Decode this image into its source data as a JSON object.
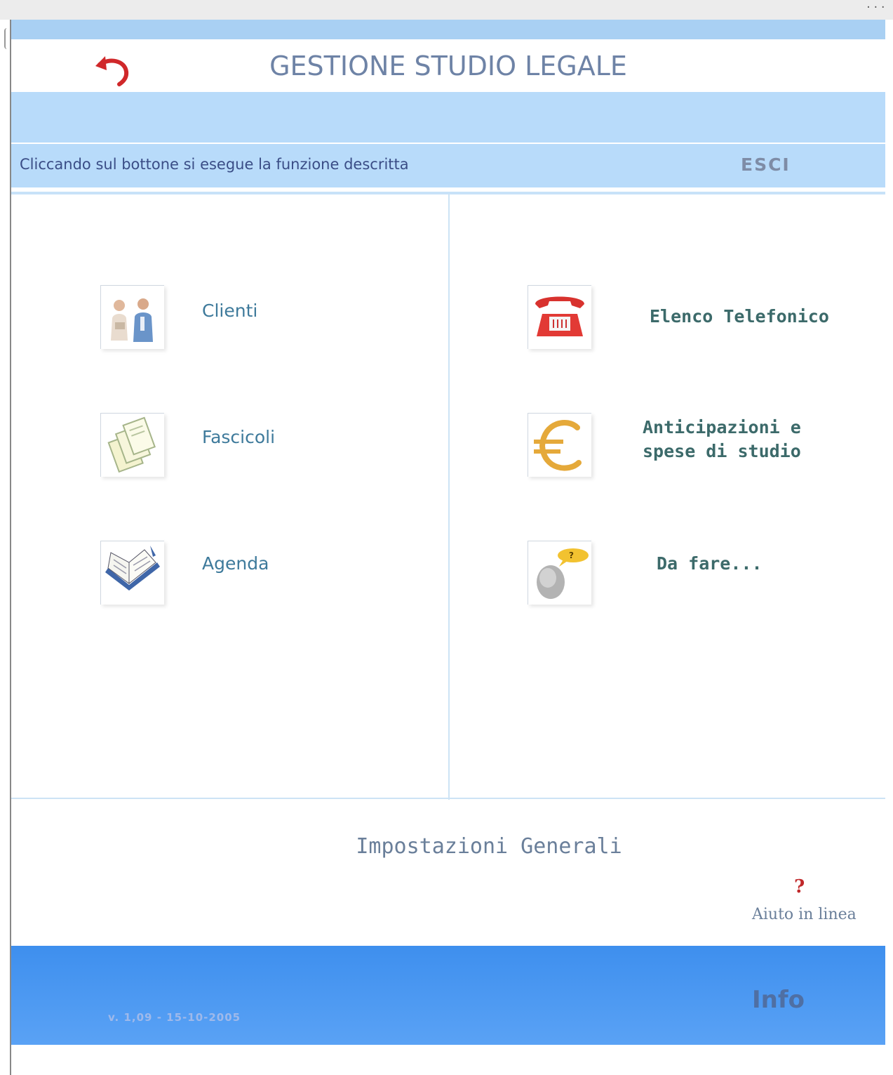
{
  "window": {
    "corner_text": "..."
  },
  "header": {
    "title": "GESTIONE STUDIO LEGALE",
    "back_icon": "back-arrow-icon",
    "info_text": "Cliccando sul bottone si esegue la funzione descritta",
    "exit_label": "ESCI"
  },
  "menu": {
    "left": [
      {
        "label": "Clienti",
        "icon": "clients-icon"
      },
      {
        "label": "Fascicoli",
        "icon": "folders-icon"
      },
      {
        "label": "Agenda",
        "icon": "agenda-book-icon"
      }
    ],
    "right": [
      {
        "label": "Elenco Telefonico",
        "icon": "telephone-icon"
      },
      {
        "label_line1": "Anticipazioni e",
        "label_line2": "spese di studio",
        "icon": "euro-icon"
      },
      {
        "label": "Da fare...",
        "icon": "thinking-head-icon"
      }
    ]
  },
  "settings": {
    "label": "Impostazioni Generali"
  },
  "help": {
    "symbol": "?",
    "label": "Aiuto in linea"
  },
  "footer": {
    "version": "v. 1,09 - 15-10-2005",
    "info_label": "Info"
  },
  "colors": {
    "accent_light": "#b8dbfa",
    "footer_blue": "#4a98f2",
    "title_text": "#6e83a6",
    "back_arrow": "#d0282a"
  }
}
